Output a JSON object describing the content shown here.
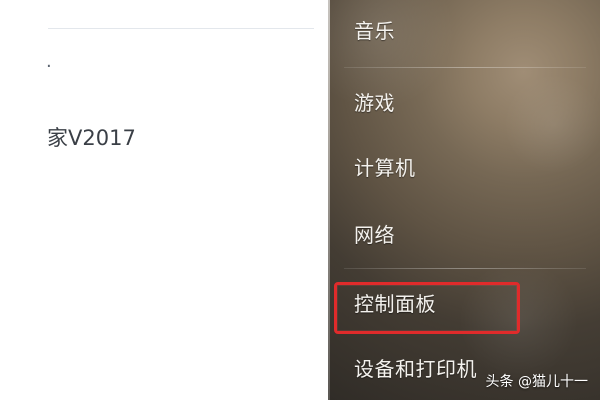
{
  "left_panel": {
    "dot": "·",
    "item_fragment": "家V2017"
  },
  "start_menu": {
    "items": [
      {
        "label": "音乐"
      },
      {
        "label": "游戏"
      },
      {
        "label": "计算机"
      },
      {
        "label": "网络"
      },
      {
        "label": "控制面板",
        "highlighted": true
      },
      {
        "label": "设备和打印机"
      }
    ]
  },
  "watermark": {
    "text": "头条 @猫儿十一"
  },
  "colors": {
    "highlight_border": "#e02b2b",
    "menu_text": "#f4f2ee",
    "left_text": "#3a3f46"
  }
}
